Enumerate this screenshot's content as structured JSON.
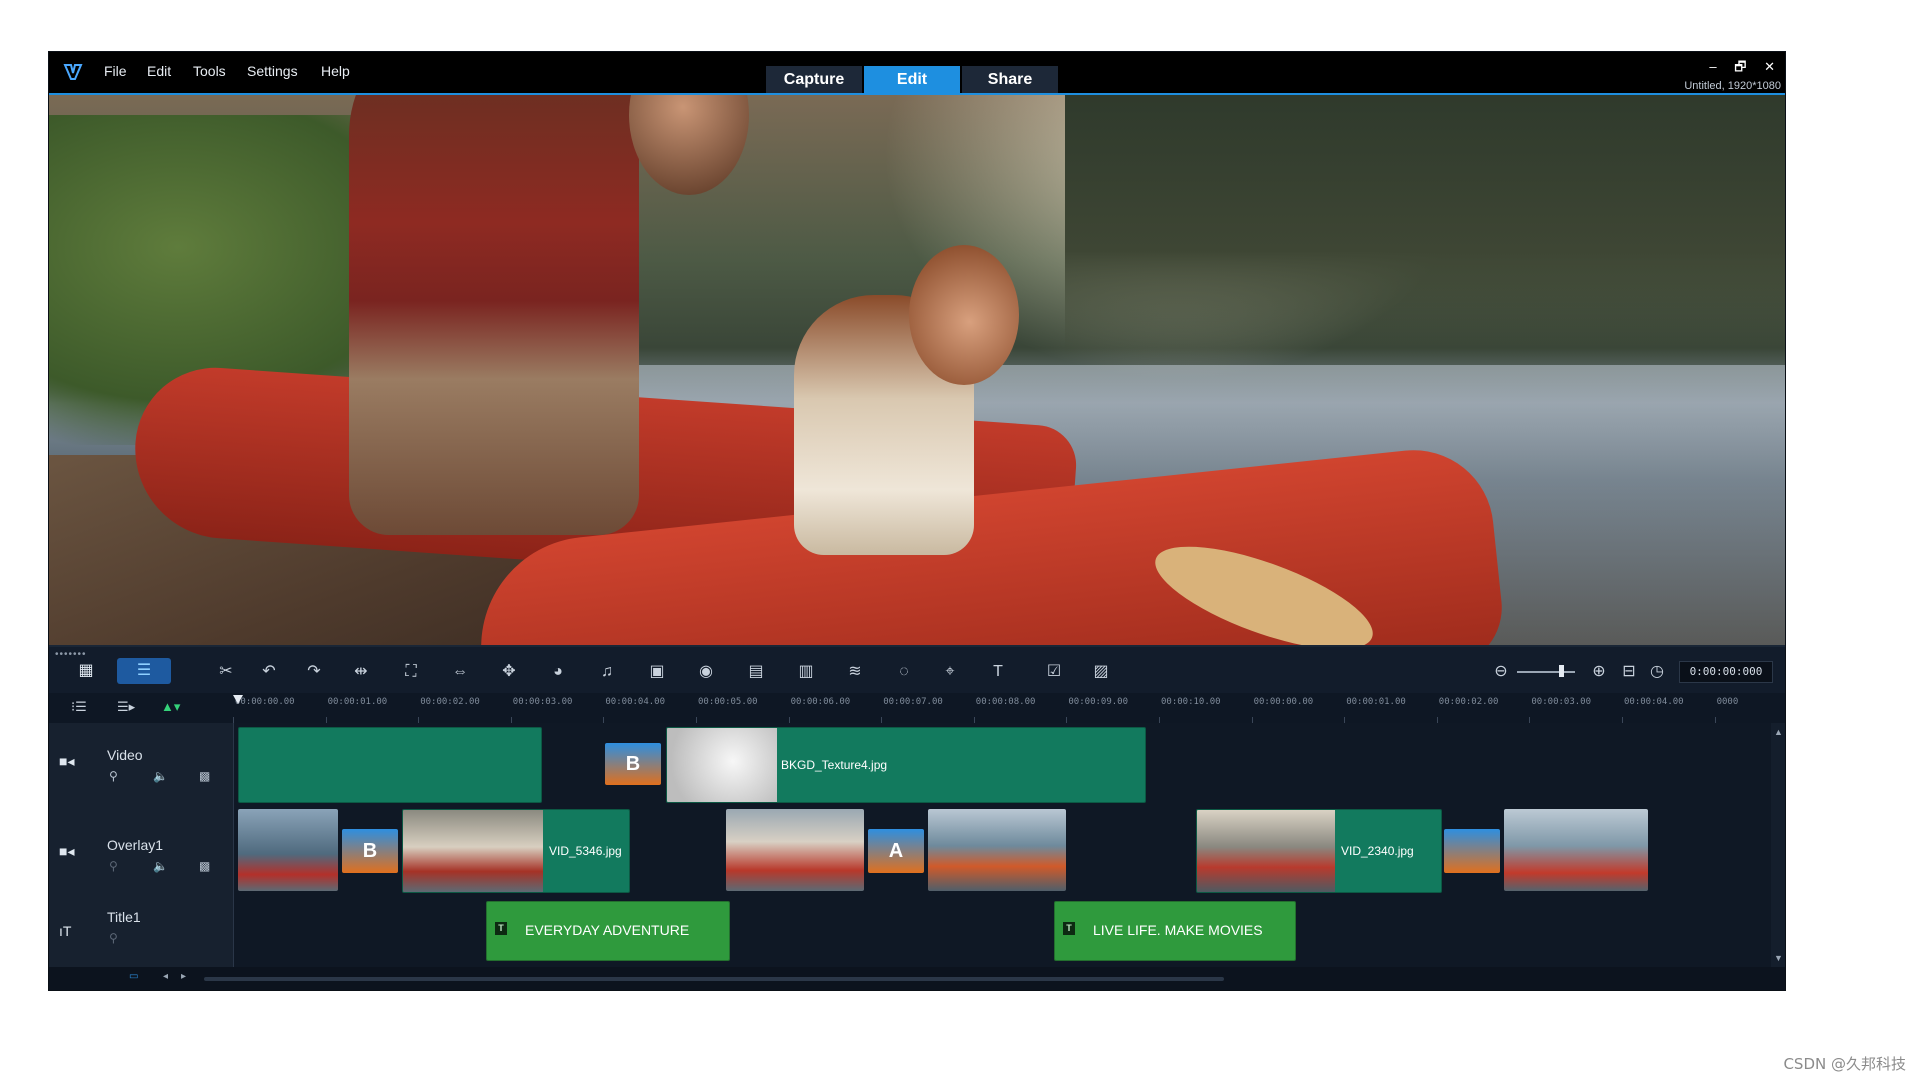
{
  "menu": {
    "items": [
      "File",
      "Edit",
      "Tools",
      "Settings",
      "Help"
    ]
  },
  "tabs": [
    {
      "label": "Capture",
      "active": false
    },
    {
      "label": "Edit",
      "active": true
    },
    {
      "label": "Share",
      "active": false
    }
  ],
  "window_controls": {
    "minimize": "–",
    "restore": "🗗",
    "close": "✕"
  },
  "project_info": "Untitled, 1920*1080",
  "toolbar": {
    "view_storyboard_icon": "storyboard-icon",
    "view_timeline_icon": "timeline-icon",
    "timecode": "0:00:00:000"
  },
  "ruler": {
    "labels": [
      "00:00:00.00",
      "00:00:01.00",
      "00:00:02.00",
      "00:00:03.00",
      "00:00:04.00",
      "00:00:05.00",
      "00:00:06.00",
      "00:00:07.00",
      "00:00:08.00",
      "00:00:09.00",
      "00:00:10.00",
      "00:00:00.00",
      "00:00:01.00",
      "00:00:02.00",
      "00:00:03.00",
      "00:00:04.00",
      "0000"
    ]
  },
  "tracks": {
    "video": {
      "name": "Video",
      "clips": {
        "bkgd_label": "BKGD_Texture4.jpg"
      }
    },
    "overlay": {
      "name": "Overlay1",
      "clips": {
        "vid1_label": "VID_5346.jpg",
        "vid2_label": "VID_2340.jpg"
      }
    },
    "title": {
      "name": "Title1",
      "clips": {
        "title1_label": "EVERYDAY ADVENTURE",
        "title2_label": "LIVE LIFE. MAKE MOVIES"
      }
    }
  },
  "transitions": {
    "b_glyph": "B",
    "a_glyph": "A"
  },
  "colors": {
    "accent": "#1e8fe0",
    "video_clip": "#127a5e",
    "title_clip": "#2f9a3d"
  },
  "watermark": "CSDN @久邦科技"
}
